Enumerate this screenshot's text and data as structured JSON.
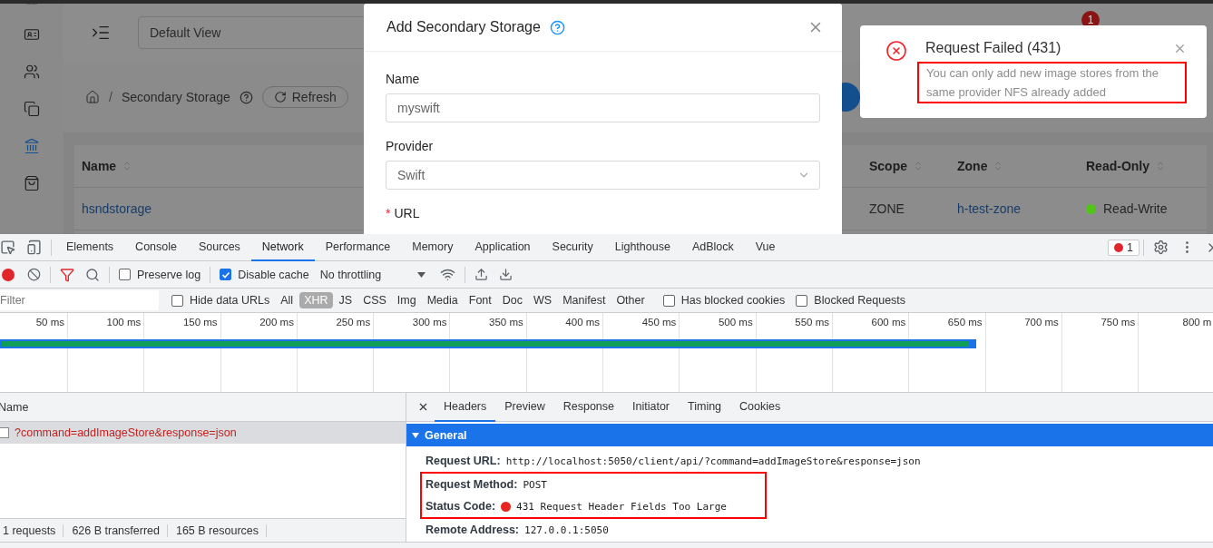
{
  "app": {
    "sidebar_items": [
      {
        "selected": false
      },
      {
        "selected": false
      },
      {
        "selected": false
      },
      {
        "selected": false
      },
      {
        "selected": true
      },
      {
        "selected": false
      }
    ],
    "view_select": "Default View",
    "notification_count": "1",
    "breadcrumb": {
      "separator": "/",
      "current": "Secondary Storage"
    },
    "refresh_button": "Refresh",
    "table": {
      "columns": [
        {
          "label": "Name"
        },
        {
          "label": "Scope"
        },
        {
          "label": "Zone"
        },
        {
          "label": "Read-Only"
        }
      ],
      "rows": [
        {
          "name": "hsndstorage",
          "scope": "ZONE",
          "zone": "h-test-zone",
          "read_only": "Read-Write",
          "color": "#52c41a"
        }
      ]
    }
  },
  "modal": {
    "title": "Add Secondary Storage",
    "fields": [
      {
        "kind": "input",
        "label": "Name",
        "value": "myswift"
      },
      {
        "kind": "select",
        "label": "Provider",
        "value": "Swift"
      },
      {
        "kind": "label",
        "label": "URL",
        "required_mark": "*"
      }
    ]
  },
  "toast": {
    "title": "Request Failed (431)",
    "message": "You can only add new image stores from the same provider NFS already added",
    "highlighted": true
  },
  "devtools": {
    "tabs": [
      {
        "label": "Elements",
        "selected": false
      },
      {
        "label": "Console",
        "selected": false
      },
      {
        "label": "Sources",
        "selected": false
      },
      {
        "label": "Network",
        "selected": true
      },
      {
        "label": "Performance",
        "selected": false
      },
      {
        "label": "Memory",
        "selected": false
      },
      {
        "label": "Application",
        "selected": false
      },
      {
        "label": "Security",
        "selected": false
      },
      {
        "label": "Lighthouse",
        "selected": false
      },
      {
        "label": "AdBlock",
        "selected": false
      },
      {
        "label": "Vue",
        "selected": false
      }
    ],
    "error_count": "1",
    "toolbar": {
      "recording": true,
      "preserve_log": {
        "label": "Preserve log",
        "checked": false
      },
      "disable_cache": {
        "label": "Disable cache",
        "checked": true
      },
      "throttling": "No throttling"
    },
    "filter": {
      "placeholder": "Filter",
      "hide_data_urls": {
        "label": "Hide data URLs",
        "checked": false
      },
      "types": [
        {
          "label": "All",
          "selected": false
        },
        {
          "label": "XHR",
          "selected": true
        },
        {
          "label": "JS",
          "selected": false
        },
        {
          "label": "CSS",
          "selected": false
        },
        {
          "label": "Img",
          "selected": false
        },
        {
          "label": "Media",
          "selected": false
        },
        {
          "label": "Font",
          "selected": false
        },
        {
          "label": "Doc",
          "selected": false
        },
        {
          "label": "WS",
          "selected": false
        },
        {
          "label": "Manifest",
          "selected": false
        },
        {
          "label": "Other",
          "selected": false
        }
      ],
      "has_blocked_cookies": {
        "label": "Has blocked cookies",
        "checked": false
      },
      "blocked_requests": {
        "label": "Blocked Requests",
        "checked": false
      }
    },
    "timeline_ticks": [
      "50 ms",
      "100 ms",
      "150 ms",
      "200 ms",
      "250 ms",
      "300 ms",
      "350 ms",
      "400 ms",
      "450 ms",
      "500 ms",
      "550 ms",
      "600 ms",
      "650 ms",
      "700 ms",
      "750 ms",
      "800 m"
    ],
    "requests": {
      "column": "Name",
      "rows": [
        {
          "name": "?command=addImageStore&response=json",
          "selected": true,
          "failed": true
        }
      ]
    },
    "status_bar": [
      "1 requests",
      "626 B transferred",
      "165 B resources"
    ],
    "detail_tabs": [
      {
        "label": "Headers",
        "selected": true
      },
      {
        "label": "Preview",
        "selected": false
      },
      {
        "label": "Response",
        "selected": false
      },
      {
        "label": "Initiator",
        "selected": false
      },
      {
        "label": "Timing",
        "selected": false
      },
      {
        "label": "Cookies",
        "selected": false
      }
    ],
    "general": {
      "title": "General",
      "expanded": true,
      "rows": [
        {
          "label": "Request URL:",
          "value": "http://localhost:5050/client/api/?command=addImageStore&response=json",
          "highlighted": false
        },
        {
          "label": "Request Method:",
          "value": "POST",
          "highlighted": true
        },
        {
          "label": "Status Code:",
          "value": "431 Request Header Fields Too Large",
          "color": "#e8251f",
          "highlighted": true
        },
        {
          "label": "Remote Address:",
          "value": "127.0.0.1:5050",
          "highlighted": false
        }
      ]
    }
  }
}
